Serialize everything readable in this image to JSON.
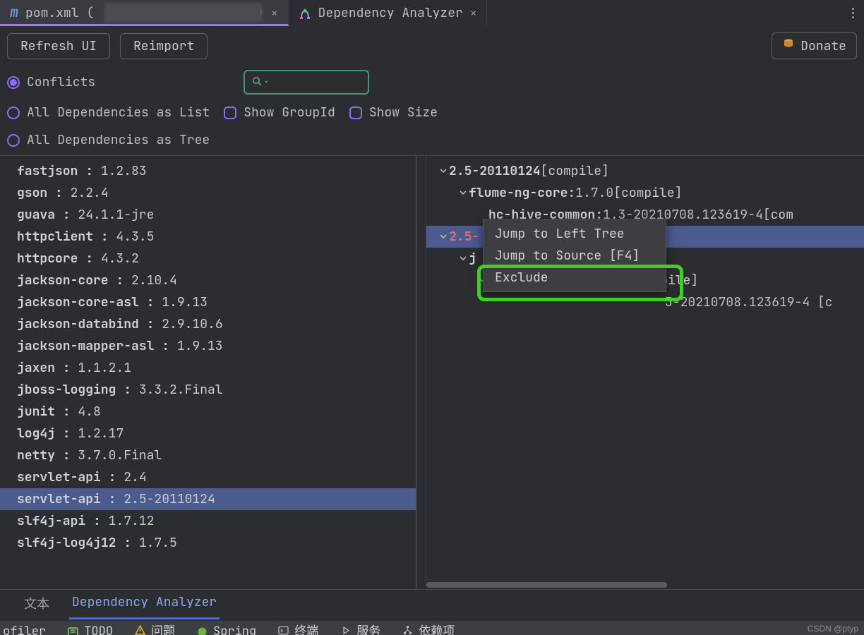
{
  "tabs": [
    {
      "label": "pom.xml (",
      "suffix": ")",
      "active": true
    },
    {
      "label": "Dependency Analyzer",
      "active": false
    }
  ],
  "toolbar": {
    "refresh": "Refresh UI",
    "reimport": "Reimport",
    "donate": "Donate"
  },
  "filters": {
    "conflicts": "Conflicts",
    "all_list": "All Dependencies as List",
    "all_tree": "All Dependencies as Tree",
    "show_groupid": "Show GroupId",
    "show_size": "Show Size"
  },
  "search": {
    "placeholder": ""
  },
  "left_panel": {
    "items": [
      {
        "name": "fastjson",
        "ver": "1.2.83"
      },
      {
        "name": "gson",
        "ver": "2.2.4"
      },
      {
        "name": "guava",
        "ver": "24.1.1-jre"
      },
      {
        "name": "httpclient",
        "ver": "4.3.5"
      },
      {
        "name": "httpcore",
        "ver": "4.3.2"
      },
      {
        "name": "jackson-core",
        "ver": "2.10.4"
      },
      {
        "name": "jackson-core-asl",
        "ver": "1.9.13"
      },
      {
        "name": "jackson-databind",
        "ver": "2.9.10.6"
      },
      {
        "name": "jackson-mapper-asl",
        "ver": "1.9.13"
      },
      {
        "name": "jaxen",
        "ver": "1.1.2.1"
      },
      {
        "name": "jboss-logging",
        "ver": "3.3.2.Final"
      },
      {
        "name": "junit",
        "ver": "4.8"
      },
      {
        "name": "log4j",
        "ver": "1.2.17"
      },
      {
        "name": "netty",
        "ver": "3.7.0.Final"
      },
      {
        "name": "servlet-api",
        "ver": "2.4"
      },
      {
        "name": "servlet-api",
        "ver": "2.5-20110124",
        "selected": true
      },
      {
        "name": "slf4j-api",
        "ver": "1.7.12"
      },
      {
        "name": "slf4j-log4j12",
        "ver": "1.7.5"
      }
    ]
  },
  "right_panel": {
    "tree": [
      {
        "indent": 1,
        "chev": "v",
        "label": "2.5-20110124",
        "scope": "[compile]"
      },
      {
        "indent": 2,
        "chev": "v",
        "label": "flume-ng-core",
        "ver": "1.7.0",
        "scope": "[compile]"
      },
      {
        "indent": 3,
        "chev": "",
        "label": "hc-hive-common",
        "ver": "1.3-20210708.123619-4",
        "scope": "[com"
      },
      {
        "indent": 1,
        "chev": "v",
        "label": "2.5-",
        "conflict": true,
        "selected": true
      },
      {
        "indent": 2,
        "chev": "v",
        "label": "j"
      },
      {
        "indent": 3,
        "chev": "v",
        "label": "",
        "scope_tail": "[compile]"
      },
      {
        "indent": 3,
        "chev": "",
        "label": "",
        "ver_tail": "3-20210708.123619-4 [c"
      }
    ],
    "context_menu": {
      "items": [
        "Jump to Left Tree",
        "Jump to Source [F4]",
        "Exclude"
      ]
    }
  },
  "bottom_tabs": {
    "text": "文本",
    "analyzer": "Dependency Analyzer"
  },
  "status": {
    "items": [
      {
        "txt": "ofiler",
        "icon": ""
      },
      {
        "txt": "TODO",
        "icon": "todo"
      },
      {
        "txt": "问题",
        "icon": "warn"
      },
      {
        "txt": "Spring",
        "icon": "spring"
      },
      {
        "txt": "终端",
        "icon": "term"
      },
      {
        "txt": "服务",
        "icon": "svc"
      },
      {
        "txt": "依赖项",
        "icon": "dep"
      }
    ]
  },
  "watermark": "CSDN @ptyp"
}
